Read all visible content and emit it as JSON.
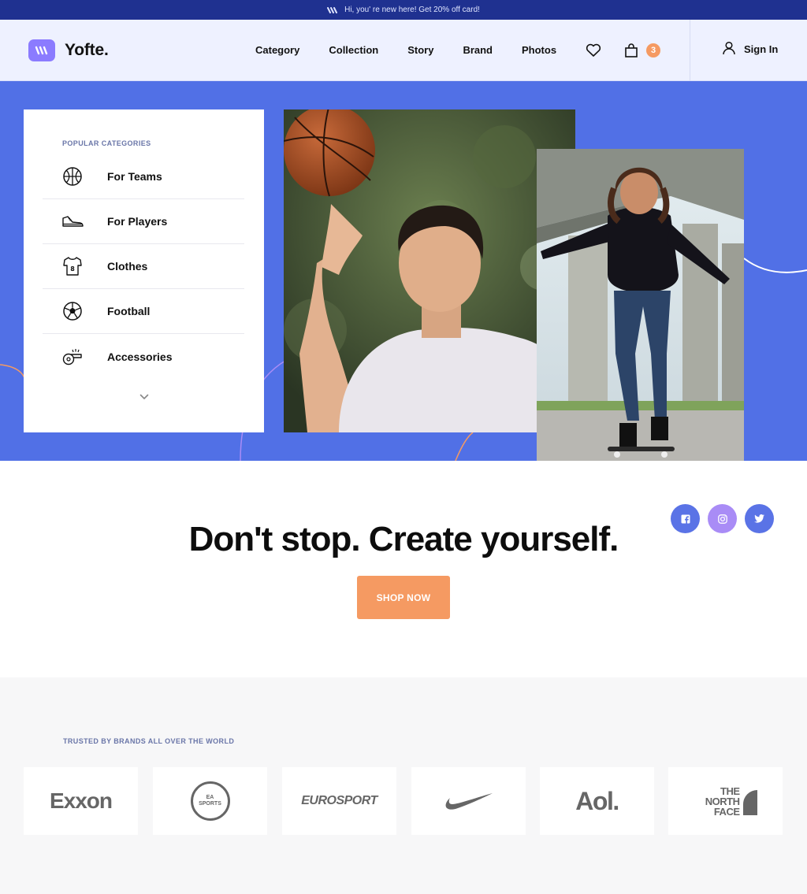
{
  "announcement": {
    "text": "Hi, you' re new here! Get 20% off card!"
  },
  "header": {
    "brand_name": "Yofte.",
    "nav": [
      "Category",
      "Collection",
      "Story",
      "Brand",
      "Photos"
    ],
    "cart_count": "3",
    "signin_label": "Sign In"
  },
  "categories": {
    "heading": "POPULAR CATEGORIES",
    "items": [
      {
        "label": "For Teams",
        "icon": "basketball-icon"
      },
      {
        "label": "For Players",
        "icon": "sneaker-icon"
      },
      {
        "label": "Clothes",
        "icon": "jersey-icon"
      },
      {
        "label": "Football",
        "icon": "soccer-ball-icon"
      },
      {
        "label": "Accessories",
        "icon": "whistle-icon"
      }
    ]
  },
  "hero": {
    "tagline": "Don't stop. Create yourself.",
    "cta_label": "SHOP NOW"
  },
  "social": [
    "facebook-icon",
    "instagram-icon",
    "twitter-icon"
  ],
  "brands": {
    "heading": "TRUSTED BY BRANDS ALL OVER THE WORLD",
    "logos": [
      "Exxon",
      "EA SPORTS",
      "EUROSPORT",
      "Nike",
      "Aol.",
      "THE NORTH FACE"
    ]
  },
  "colors": {
    "accent": "#5170e6",
    "orange": "#f59a62",
    "topbar": "#1f3190",
    "header_bg": "#eef1ff"
  }
}
